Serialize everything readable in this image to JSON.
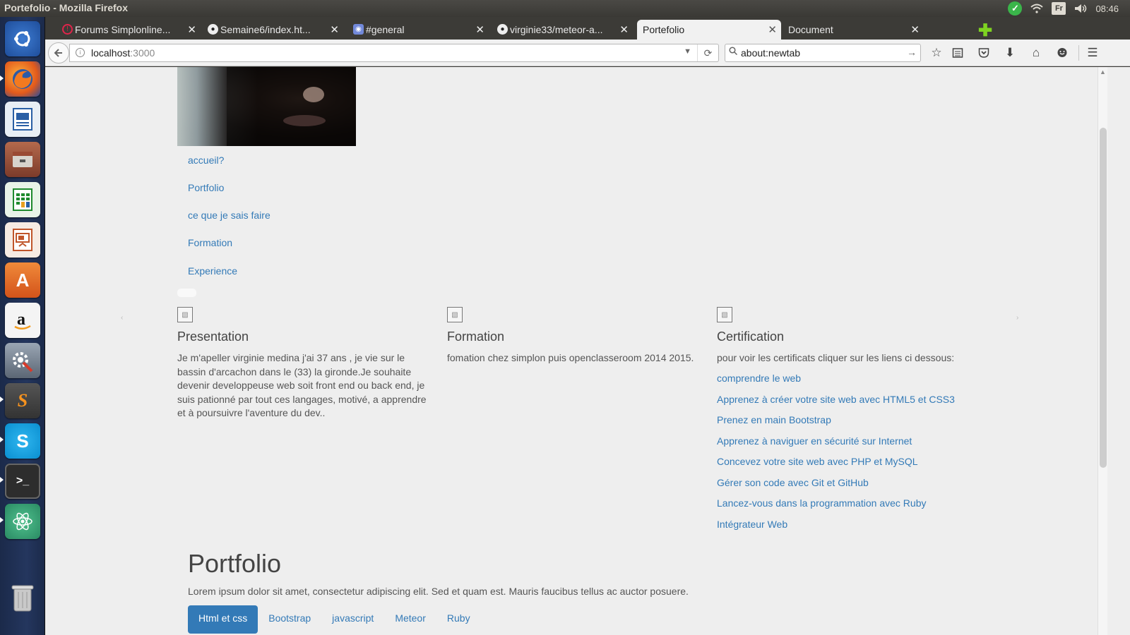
{
  "window": {
    "title": "Portefolio - Mozilla Firefox"
  },
  "panel": {
    "lang": "Fr",
    "clock": "08:46"
  },
  "launcher": {
    "apps": [
      {
        "name": "ubuntu-dash-icon"
      },
      {
        "name": "firefox-icon"
      },
      {
        "name": "writer-icon"
      },
      {
        "name": "files-icon"
      },
      {
        "name": "calc-icon"
      },
      {
        "name": "impress-icon"
      },
      {
        "name": "software-center-icon"
      },
      {
        "name": "amazon-icon"
      },
      {
        "name": "settings-icon"
      },
      {
        "name": "sublime-text-icon"
      },
      {
        "name": "skype-icon"
      },
      {
        "name": "terminal-icon"
      },
      {
        "name": "atom-icon"
      },
      {
        "name": "trash-icon"
      }
    ]
  },
  "tabs": [
    {
      "label": "Forums Simplonline...",
      "icon": "simplon-icon"
    },
    {
      "label": "Semaine6/index.ht...",
      "icon": "github-icon"
    },
    {
      "label": "#general",
      "icon": "discord-icon"
    },
    {
      "label": "virginie33/meteor-a...",
      "icon": "github-icon"
    },
    {
      "label": "Portefolio",
      "icon": ""
    },
    {
      "label": "Document",
      "icon": ""
    }
  ],
  "navbar": {
    "url_host": "localhost",
    "url_port": ":3000",
    "search_text": "about:newtab"
  },
  "sidenav": [
    "accueil?",
    "Portfolio",
    "ce que je sais faire",
    "Formation",
    "Experience"
  ],
  "columns": {
    "presentation": {
      "title": "Presentation",
      "text": "Je m'apeller virginie medina j'ai 37 ans , je vie sur le bassin d'arcachon dans le (33) la gironde.Je souhaite devenir developpeuse web soit front end ou back end, je suis pationné par tout ces langages, motivé, a apprendre et à poursuivre l'aventure du dev.."
    },
    "formation": {
      "title": "Formation",
      "text": "fomation chez simplon puis openclasseroom 2014 2015."
    },
    "certification": {
      "title": "Certification",
      "text": "pour voir les certificats cliquer sur les liens ci dessous:",
      "links": [
        "comprendre le web",
        "Apprenez à créer votre site web avec HTML5 et CSS3",
        "Prenez en main Bootstrap",
        "Apprenez à naviguer en sécurité sur Internet",
        "Concevez votre site web avec PHP et MySQL",
        "Gérer son code avec Git et GitHub",
        "Lancez-vous dans la programmation avec Ruby",
        "Intégrateur Web"
      ]
    }
  },
  "portfolio": {
    "title": "Portfolio",
    "lead": "Lorem ipsum dolor sit amet, consectetur adipiscing elit. Sed et quam est. Mauris faucibus tellus ac auctor posuere.",
    "pills": [
      "Html et css",
      "Bootstrap",
      "javascript",
      "Meteor",
      "Ruby"
    ]
  },
  "colors": {
    "link": "#337ab7",
    "page_bg": "#eeeeee",
    "panel_bg": "#3c3b37",
    "new_tab_green": "#7ed321"
  }
}
